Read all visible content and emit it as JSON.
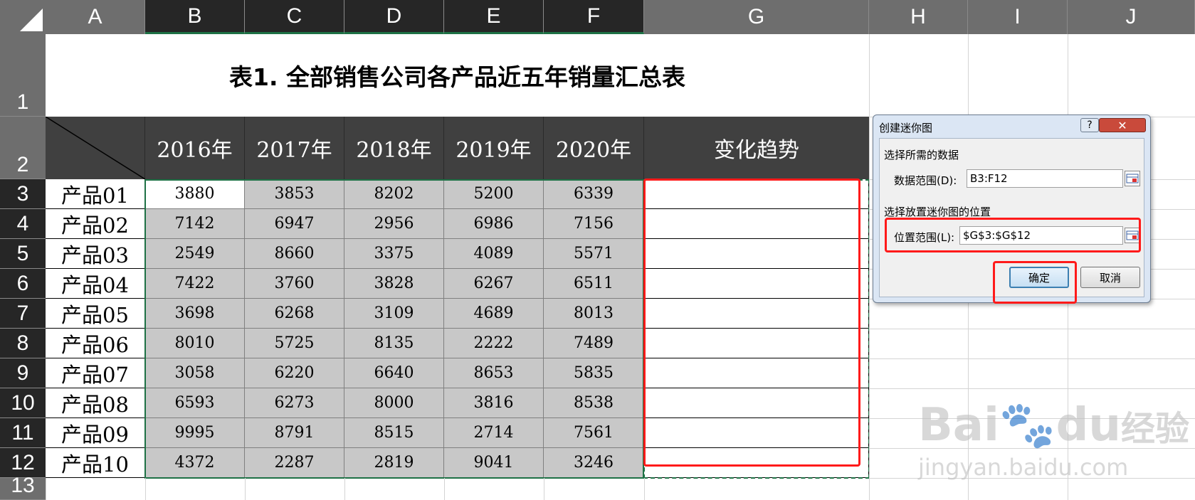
{
  "sheet": {
    "columns": [
      "A",
      "B",
      "C",
      "D",
      "E",
      "F",
      "G",
      "H",
      "I",
      "J"
    ],
    "rows": [
      "1",
      "2",
      "3",
      "4",
      "5",
      "6",
      "7",
      "8",
      "9",
      "10",
      "11",
      "12",
      "13"
    ],
    "title": "表1. 全部销售公司各产品近五年销量汇总表",
    "year_headers": [
      "2016年",
      "2017年",
      "2018年",
      "2019年",
      "2020年"
    ],
    "trend_header": "变化趋势",
    "products": [
      {
        "name": "产品01",
        "values": [
          "3880",
          "3853",
          "8202",
          "5200",
          "6339"
        ]
      },
      {
        "name": "产品02",
        "values": [
          "7142",
          "6947",
          "2956",
          "6986",
          "7156"
        ]
      },
      {
        "name": "产品03",
        "values": [
          "2549",
          "8660",
          "3375",
          "4089",
          "5571"
        ]
      },
      {
        "name": "产品04",
        "values": [
          "7422",
          "3760",
          "3828",
          "6267",
          "6511"
        ]
      },
      {
        "name": "产品05",
        "values": [
          "3698",
          "6268",
          "3109",
          "4689",
          "8013"
        ]
      },
      {
        "name": "产品06",
        "values": [
          "8010",
          "5725",
          "8135",
          "2222",
          "7489"
        ]
      },
      {
        "name": "产品07",
        "values": [
          "3058",
          "6220",
          "6640",
          "8653",
          "5835"
        ]
      },
      {
        "name": "产品08",
        "values": [
          "6593",
          "6273",
          "8000",
          "3816",
          "8538"
        ]
      },
      {
        "name": "产品09",
        "values": [
          "9995",
          "8791",
          "8515",
          "2714",
          "7561"
        ]
      },
      {
        "name": "产品10",
        "values": [
          "4372",
          "2287",
          "2819",
          "9041",
          "3246"
        ]
      }
    ]
  },
  "dialog": {
    "title": "创建迷你图",
    "help_label": "?",
    "close_label": "✕",
    "section_data": "选择所需的数据",
    "data_range_label": "数据范围(D):",
    "data_range_value": "B3:F12",
    "section_location": "选择放置迷你图的位置",
    "location_range_label": "位置范围(L):",
    "location_range_value": "$G$3:$G$12",
    "ok_label": "确定",
    "cancel_label": "取消"
  },
  "watermark": {
    "brand": "Bai",
    "brand2": "du",
    "brand_cn": "经验",
    "url": "jingyan.baidu.com"
  },
  "colors": {
    "header_bg": "#6e6e6e",
    "selected_header_bg": "#262626",
    "table_header_bg": "#404040",
    "selection_fill": "#c8c8c8",
    "highlight_red": "#ff1a1a",
    "excel_green": "#1e7145"
  }
}
